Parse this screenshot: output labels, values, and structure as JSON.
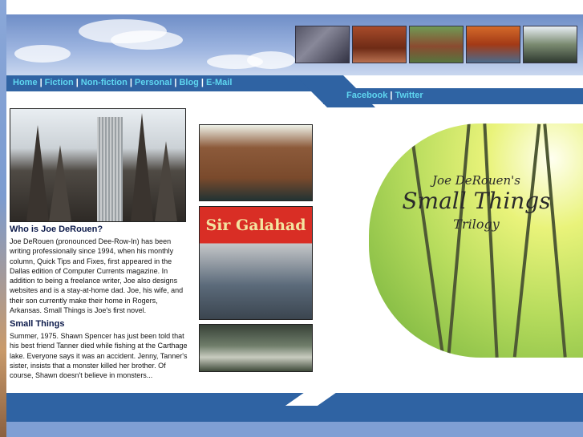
{
  "nav": {
    "items": [
      "Home",
      "Fiction",
      "Non-fiction",
      "Personal",
      "Blog",
      "E-Mail"
    ],
    "separator": "|"
  },
  "social": {
    "items": [
      "Facebook",
      "Twitter"
    ],
    "separator": "|"
  },
  "about": {
    "heading": "Who is Joe DeRouen?",
    "body": "Joe DeRouen (pronounced Dee-Row-In) has been writing professionally since 1994, when his monthly column, Quick Tips and Fixes, first appeared in the Dallas edition of Computer Currents magazine. In addition to being a freelance writer, Joe also designs websites and is a stay-at-home dad. Joe, his wife, and their son currently make their home in Rogers, Arkansas. Small Things is Joe's first novel."
  },
  "small_things": {
    "heading": "Small Things",
    "body": "Summer, 1975. Shawn Spencer has just been told that his best friend Tanner died while fishing at the Carthage lake. Everyone says it was an accident. Jenny, Tanner's sister, insists that a monster killed her brother. Of course, Shawn doesn't believe in monsters..."
  },
  "toy_photo": {
    "label": "Sir Galahad"
  },
  "book_cover": {
    "line1": "Joe DeRouen's",
    "line2": "Small Things",
    "line3": "Trilogy"
  }
}
